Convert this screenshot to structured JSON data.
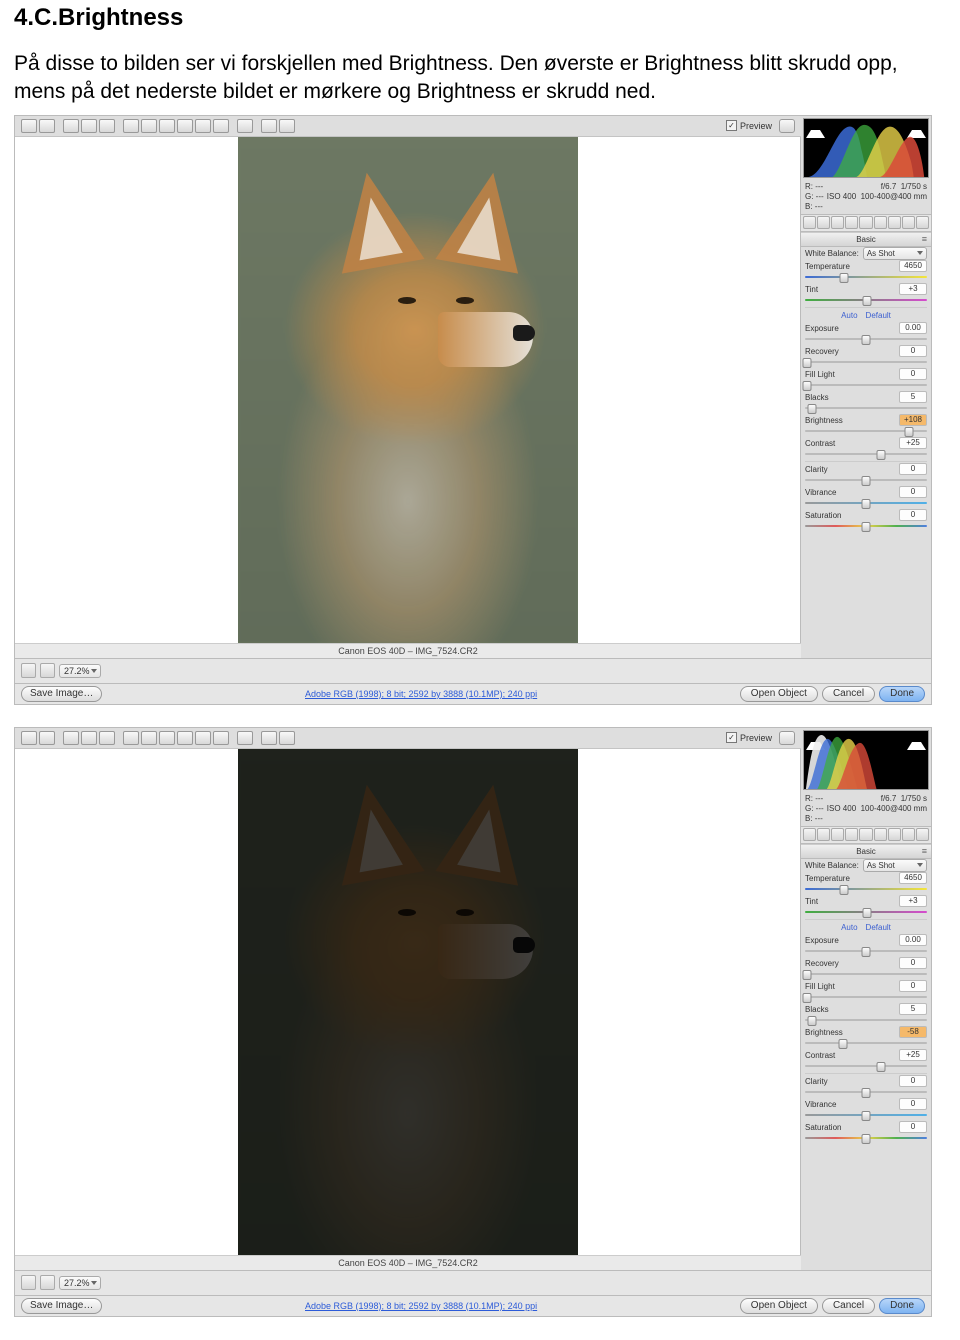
{
  "doc": {
    "heading": "4.C.Brightness",
    "intro": "På disse to bilden ser vi forskjellen med Brightness. Den øverste er Brightness blitt skrudd opp, mens på det nederste bildet er mørkere og Brightness er skrudd ned."
  },
  "common": {
    "preview_label": "Preview",
    "photo_caption": "Canon EOS 40D  –  IMG_7524.CR2",
    "meta": {
      "r": "R:  ---",
      "g": "G:  ---",
      "b": "B:  ---",
      "aperture": "f/6.7",
      "shutter": "1/750 s",
      "iso": "ISO 400",
      "lens": "100-400@400 mm"
    },
    "panel_basic": "Basic",
    "wb_label": "White Balance:",
    "wb_value": "As Shot",
    "temperature_label": "Temperature",
    "temperature_value": "4650",
    "tint_label": "Tint",
    "tint_value": "+3",
    "auto": "Auto",
    "default": "Default",
    "exposure_label": "Exposure",
    "exposure_value": "0.00",
    "recovery_label": "Recovery",
    "recovery_value": "0",
    "filllight_label": "Fill Light",
    "filllight_value": "0",
    "blacks_label": "Blacks",
    "blacks_value": "5",
    "brightness_label": "Brightness",
    "contrast_label": "Contrast",
    "contrast_value": "+25",
    "clarity_label": "Clarity",
    "clarity_value": "0",
    "vibrance_label": "Vibrance",
    "vibrance_value": "0",
    "saturation_label": "Saturation",
    "saturation_value": "0",
    "zoom": "27.2%",
    "save_btn": "Save Image…",
    "center_link": "Adobe RGB (1998); 8 bit; 2592 by 3888 (10.1MP); 240 ppi",
    "open_btn": "Open Object",
    "cancel_btn": "Cancel",
    "done_btn": "Done"
  },
  "top": {
    "brightness_value": "+108",
    "brightness_thumb_pct": 85
  },
  "bottom": {
    "brightness_value": "-58",
    "brightness_thumb_pct": 31
  }
}
